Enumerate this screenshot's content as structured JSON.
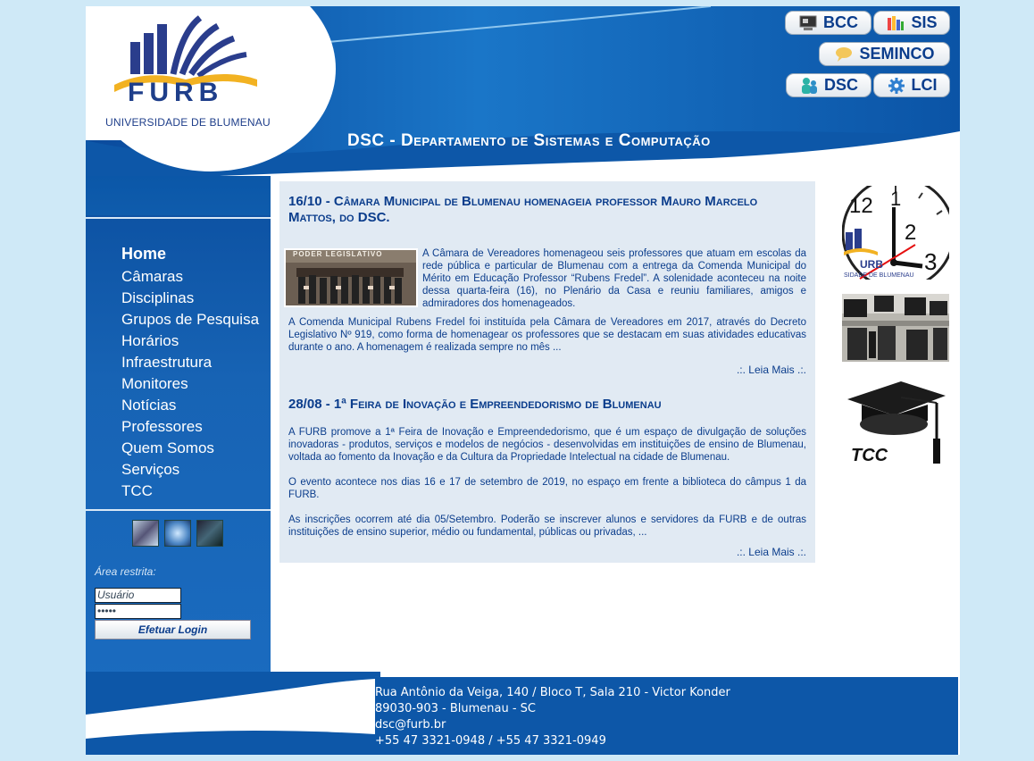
{
  "header": {
    "logo_text": "FURB",
    "logo_subtitle": "UNIVERSIDADE DE BLUMENAU",
    "department_title": "DSC - Departamento de Sistemas e Computação",
    "buttons": [
      {
        "label": "BCC",
        "icon": "computer-icon"
      },
      {
        "label": "SIS",
        "icon": "books-icon"
      },
      {
        "label": "SEMINCO",
        "icon": "speech-bubble-icon"
      },
      {
        "label": "DSC",
        "icon": "people-icon"
      },
      {
        "label": "LCI",
        "icon": "gear-icon"
      }
    ]
  },
  "nav": {
    "items": [
      "Home",
      "Câmaras",
      "Disciplinas",
      "Grupos de Pesquisa",
      "Horários",
      "Infraestrutura",
      "Monitores",
      "Notícias",
      "Professores",
      "Quem Somos",
      "Serviços",
      "TCC"
    ]
  },
  "login": {
    "label": "Área restrita:",
    "user_placeholder": "Usuário",
    "password_value": "•••••",
    "button": "Efetuar Login"
  },
  "news": [
    {
      "title": "16/10 - Câmara Municipal de Blumenau homenageia professor Mauro Marcelo Mattos, do DSC.",
      "image_caption": "PODER LEGISLATIVO",
      "paragraphs": [
        "A Câmara de Vereadores homenageou seis professores que atuam em escolas da rede pública e particular de Blumenau com a entrega da Comenda Municipal do Mérito em Educação Professor “Rubens Fredel”. A solenidade aconteceu na noite dessa quarta-feira (16), no Plenário da Casa e reuniu familiares, amigos e admiradores dos homenageados.",
        "A Comenda Municipal Rubens Fredel foi instituída pela Câmara de Vereadores em 2017, através do Decreto Legislativo Nº 919, como forma de homenagear os professores que se destacam em suas atividades educativas durante o ano. A homenagem é realizada sempre no mês ..."
      ],
      "more": ".:. Leia Mais .:."
    },
    {
      "title": "28/08 - 1ª Feira de Inovação e Empreendedorismo de Blumenau",
      "paragraphs": [
        "A FURB promove a 1ª Feira de Inovação e Empreendedorismo, que é um espaço de divulgação de soluções inovadoras - produtos, serviços e modelos de negócios - desenvolvidas em instituições de ensino de Blumenau, voltada ao fomento da Inovação e da Cultura da Propriedade Intelectual na cidade de Blumenau.",
        "O evento acontece nos dias 16 e 17 de setembro de 2019, no espaço em frente a biblioteca do câmpus 1 da FURB.",
        "As inscrições ocorrem até dia 05/Setembro. Poderão se inscrever alunos e servidores da FURB e de outras instituições de ensino superior, médio ou fundamental, públicas ou privadas, ..."
      ],
      "more": ".:. Leia Mais .:."
    }
  ],
  "sidebar_right": {
    "clock_text": "URB",
    "clock_sub": "SIDADE DE BLUMENAU",
    "tcc_label": "TCC"
  },
  "footer": {
    "lines": [
      "Rua Antônio da Veiga, 140 / Bloco T, Sala 210 - Victor Konder",
      "89030-903 - Blumenau - SC",
      "dsc@furb.br",
      "+55 47 3321-0948 / +55 47 3321-0949"
    ]
  },
  "colors": {
    "primary": "#0b4fa0",
    "text": "#0b3d8c",
    "panel": "#e1eaf3",
    "background": "#cfe9f7"
  }
}
